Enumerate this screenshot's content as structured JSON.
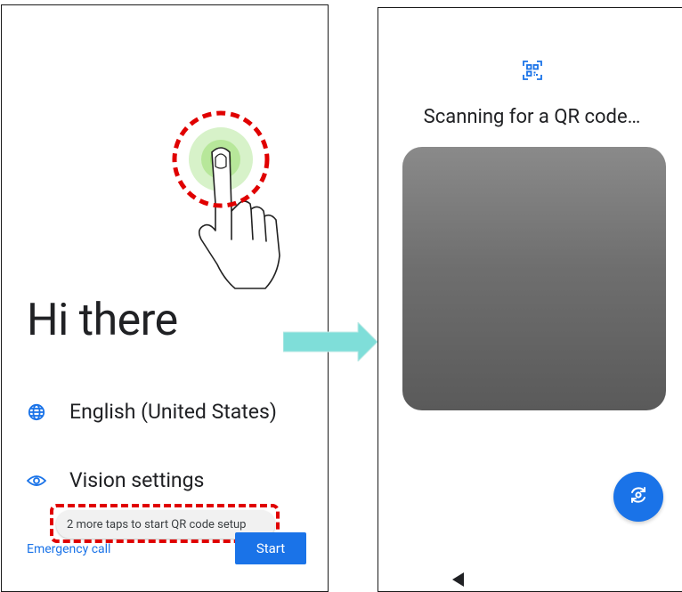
{
  "left_screen": {
    "title": "Hi there",
    "language_label": "English (United States)",
    "vision_label": "Vision settings",
    "toast_text": "2 more taps to start QR code setup",
    "emergency_label": "Emergency call",
    "start_label": "Start",
    "icons": {
      "language": "globe-icon",
      "vision": "eye-icon",
      "gesture": "tapping-hand-icon"
    }
  },
  "right_screen": {
    "title": "Scanning for a QR code…",
    "icons": {
      "header": "qr-code-scan-icon",
      "switch_camera": "camera-switch-icon",
      "nav": "back-triangle-icon"
    }
  },
  "colors": {
    "accent": "#1a73e8",
    "highlight": "#e00000",
    "arrow": "#7fded9",
    "text": "#202124"
  }
}
